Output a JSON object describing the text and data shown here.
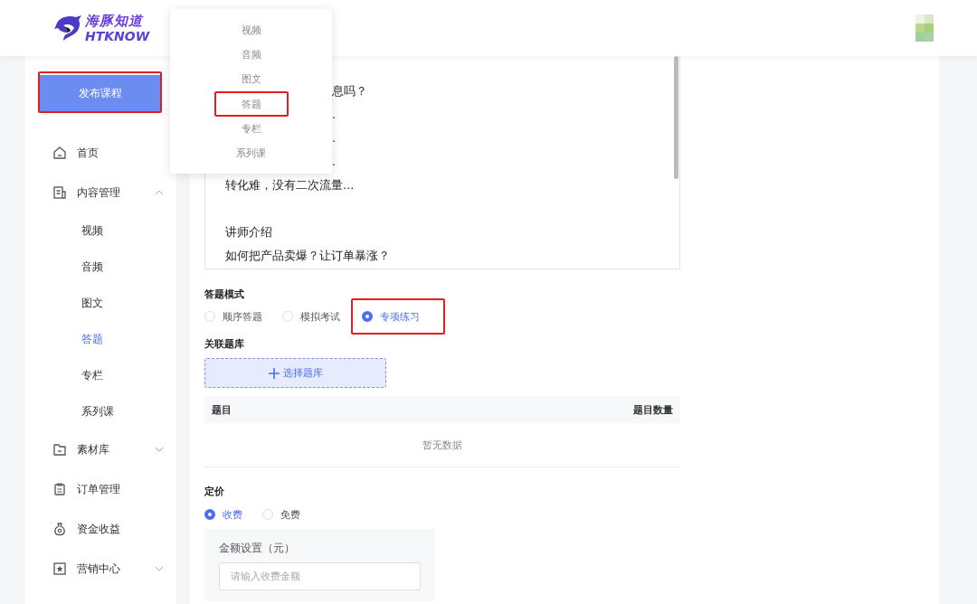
{
  "header": {
    "logo_cn": "海豚知道",
    "logo_en": "HTKNOW"
  },
  "publish_button": {
    "label": "发布课程",
    "highlighted": true
  },
  "dropdown": {
    "items": [
      {
        "label": "视频",
        "highlighted": false
      },
      {
        "label": "音频",
        "highlighted": false
      },
      {
        "label": "图文",
        "highlighted": false
      },
      {
        "label": "答题",
        "highlighted": true
      },
      {
        "label": "专栏",
        "highlighted": false
      },
      {
        "label": "系列课",
        "highlighted": false
      }
    ]
  },
  "sidebar": {
    "items": [
      {
        "label": "首页",
        "kind": "link"
      },
      {
        "label": "内容管理",
        "kind": "group",
        "expanded": true,
        "children": [
          {
            "label": "视频",
            "selected": false
          },
          {
            "label": "音频",
            "selected": false
          },
          {
            "label": "图文",
            "selected": false
          },
          {
            "label": "答题",
            "selected": true
          },
          {
            "label": "专栏",
            "selected": false
          },
          {
            "label": "系列课",
            "selected": false
          }
        ]
      },
      {
        "label": "素材库",
        "kind": "group",
        "expanded": false
      },
      {
        "label": "订单管理",
        "kind": "link"
      },
      {
        "label": "资金收益",
        "kind": "link"
      },
      {
        "label": "营销中心",
        "kind": "group",
        "expanded": false
      }
    ]
  },
  "editor": {
    "lines": [
      {
        "text": "息吗？",
        "kind": "fragment"
      },
      {
        "text": ".",
        "kind": "fragment"
      },
      {
        "text": ".",
        "kind": "fragment"
      },
      {
        "text": ".",
        "kind": "fragment"
      },
      {
        "text": "转化难，没有二次流量...",
        "kind": "line"
      },
      {
        "text": "讲师介绍",
        "kind": "heading"
      },
      {
        "text": "如何把产品卖爆？让订单暴涨？",
        "kind": "line"
      }
    ]
  },
  "answer_mode": {
    "label": "答题模式",
    "options": [
      {
        "label": "顺序答题",
        "selected": false,
        "highlighted": false
      },
      {
        "label": "模拟考试",
        "selected": false,
        "highlighted": false
      },
      {
        "label": "专项练习",
        "selected": true,
        "highlighted": true
      }
    ]
  },
  "question_bank": {
    "label": "关联题库",
    "button": "选择题库",
    "table": {
      "columns": [
        "题目",
        "题目数量"
      ],
      "empty_text": "暂无数据"
    }
  },
  "pricing": {
    "label": "定价",
    "options": [
      {
        "label": "收费",
        "selected": true
      },
      {
        "label": "免费",
        "selected": false
      }
    ],
    "amount": {
      "label": "金额设置（元）",
      "placeholder": "请输入收费金额"
    }
  }
}
